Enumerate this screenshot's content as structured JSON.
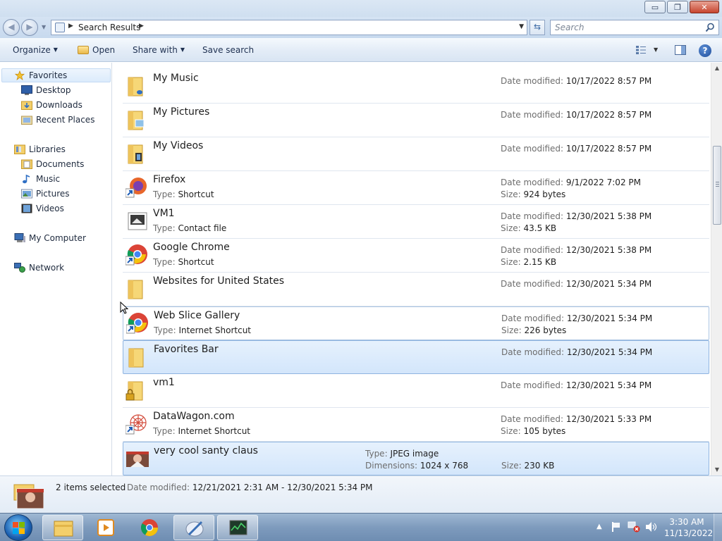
{
  "window": {
    "controls": {
      "minimize": "▭",
      "restore": "❐",
      "close": "✕"
    }
  },
  "address": {
    "path": "Search Results",
    "search_placeholder": "Search"
  },
  "toolbar": {
    "organize": "Organize",
    "open": "Open",
    "share_with": "Share with",
    "save_search": "Save search"
  },
  "sidebar": {
    "favorites": "Favorites",
    "desktop": "Desktop",
    "downloads": "Downloads",
    "recent_places": "Recent Places",
    "libraries": "Libraries",
    "documents": "Documents",
    "music": "Music",
    "pictures": "Pictures",
    "videos": "Videos",
    "my_computer": "My Computer",
    "network": "Network"
  },
  "labels": {
    "date_modified": "Date modified:",
    "type": "Type:",
    "size": "Size:",
    "dimensions": "Dimensions:"
  },
  "items": [
    {
      "name": "My Music",
      "date": "10/17/2022 8:57 PM",
      "type": "",
      "size": ""
    },
    {
      "name": "My Pictures",
      "date": "10/17/2022 8:57 PM",
      "type": "",
      "size": ""
    },
    {
      "name": "My Videos",
      "date": "10/17/2022 8:57 PM",
      "type": "",
      "size": ""
    },
    {
      "name": "Firefox",
      "date": "9/1/2022 7:02 PM",
      "type": "Shortcut",
      "size": "924 bytes"
    },
    {
      "name": "VM1",
      "date": "12/30/2021 5:38 PM",
      "type": "Contact file",
      "size": "43.5 KB"
    },
    {
      "name": "Google Chrome",
      "date": "12/30/2021 5:38 PM",
      "type": "Shortcut",
      "size": "2.15 KB"
    },
    {
      "name": "Websites for United States",
      "date": "12/30/2021 5:34 PM",
      "type": "",
      "size": ""
    },
    {
      "name": "Web Slice Gallery",
      "date": "12/30/2021 5:34 PM",
      "type": "Internet Shortcut",
      "size": "226 bytes"
    },
    {
      "name": "Favorites Bar",
      "date": "12/30/2021 5:34 PM",
      "type": "",
      "size": ""
    },
    {
      "name": "vm1",
      "date": "12/30/2021 5:34 PM",
      "type": "",
      "size": ""
    },
    {
      "name": "DataWagon.com",
      "date": "12/30/2021 5:33 PM",
      "type": "Internet Shortcut",
      "size": "105 bytes"
    },
    {
      "name": "very cool santy claus",
      "type": "JPEG image",
      "dimensions": "1024 x 768",
      "size": "230 KB"
    }
  ],
  "details": {
    "count": "2 items selected",
    "date_label": "Date modified:",
    "date_range": "12/21/2021 2:31 AM - 12/30/2021 5:34 PM"
  },
  "taskbar": {
    "time": "3:30 AM",
    "date": "11/13/2022"
  },
  "colors": {
    "selection": "#d3e6fb",
    "selection_border": "#8fb4e0",
    "taskbar": "#7e9bbd"
  }
}
